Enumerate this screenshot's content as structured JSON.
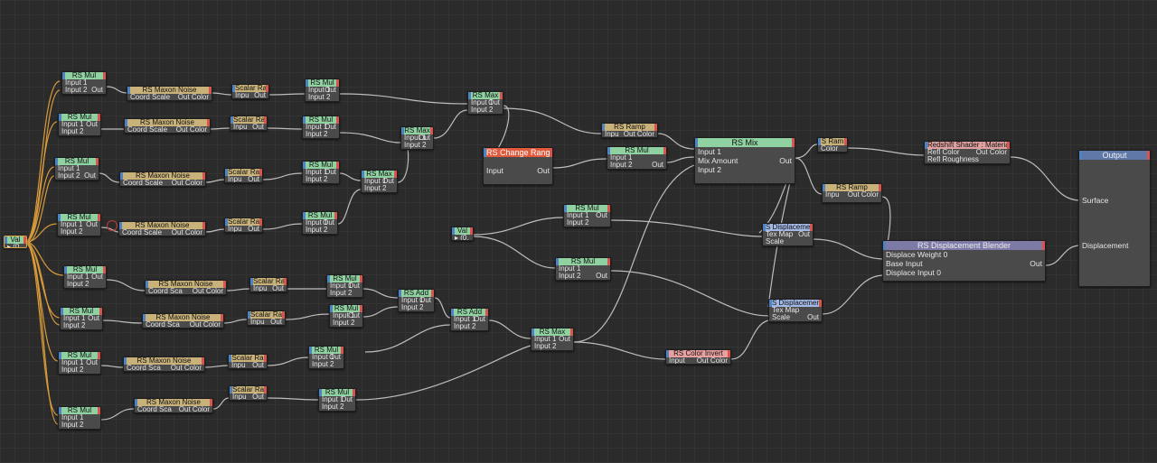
{
  "nodes": {
    "val_root": {
      "title": "Val",
      "rows": [
        [
          "▸ (0.",
          ""
        ]
      ]
    },
    "mul1": {
      "title": "RS Mul",
      "rows": [
        [
          "Input 1",
          ""
        ],
        [
          "Input 2",
          "Out"
        ]
      ]
    },
    "mul2": {
      "title": "RS Mul",
      "rows": [
        [
          "Input 1",
          "Out"
        ],
        [
          "Input 2",
          ""
        ]
      ]
    },
    "mul3": {
      "title": "RS Mul",
      "rows": [
        [
          "Input 1",
          ""
        ],
        [
          "Input 2",
          "Out"
        ]
      ]
    },
    "mul4": {
      "title": "RS Mul",
      "rows": [
        [
          "Input 1",
          "Out"
        ],
        [
          "Input 2",
          ""
        ]
      ]
    },
    "mul5": {
      "title": "RS Mul",
      "rows": [
        [
          "Input 1",
          "Out"
        ],
        [
          "Input 2",
          ""
        ]
      ]
    },
    "mul6": {
      "title": "RS Mul",
      "rows": [
        [
          "Input 1",
          "Out"
        ],
        [
          "Input 2",
          ""
        ]
      ]
    },
    "mul7": {
      "title": "RS Mul",
      "rows": [
        [
          "Input 1",
          "Out"
        ],
        [
          "Input 2",
          ""
        ]
      ]
    },
    "mul8": {
      "title": "RS Mul",
      "rows": [
        [
          "Input 1",
          ""
        ],
        [
          "Input 2",
          ""
        ]
      ]
    },
    "noise1": {
      "title": "RS Maxon Noise",
      "rows": [
        [
          "Coord Scale",
          "Out Color"
        ]
      ]
    },
    "noise2": {
      "title": "RS Maxon Noise",
      "rows": [
        [
          "Coord Scale",
          "Out Color"
        ]
      ]
    },
    "noise3": {
      "title": "RS Maxon Noise",
      "rows": [
        [
          "Coord Scale",
          "Out Color"
        ]
      ]
    },
    "noise4": {
      "title": "RS Maxon Noise",
      "rows": [
        [
          "Coord Scale",
          "Out Color"
        ]
      ]
    },
    "noise5": {
      "title": "RS Maxon Noise",
      "rows": [
        [
          "Coord Sca",
          "Out Color"
        ]
      ]
    },
    "noise6": {
      "title": "RS Maxon Noise",
      "rows": [
        [
          "Coord Sca",
          "Out Color"
        ]
      ]
    },
    "noise7": {
      "title": "RS Maxon Noise",
      "rows": [
        [
          "Coord Sca",
          "Out Color"
        ]
      ]
    },
    "noise8": {
      "title": "RS Maxon Noise",
      "rows": [
        [
          "Coord Sca",
          "Out Color"
        ]
      ]
    },
    "scal1": {
      "title": "Scalar Ra",
      "rows": [
        [
          "Inpu",
          "Out"
        ]
      ]
    },
    "scal2": {
      "title": "Scalar Ra",
      "rows": [
        [
          "Inpu",
          "Out"
        ]
      ]
    },
    "scal3": {
      "title": "Scalar Ra",
      "rows": [
        [
          "Inpu",
          "Out"
        ]
      ]
    },
    "scal4": {
      "title": "Scalar Ra",
      "rows": [
        [
          "Inpu",
          "Out"
        ]
      ]
    },
    "scal5": {
      "title": "Scalar Ra",
      "rows": [
        [
          "Inpu",
          "Out"
        ]
      ]
    },
    "scal6": {
      "title": "Scalar Ra",
      "rows": [
        [
          "Inpu",
          "Out"
        ]
      ]
    },
    "scal7": {
      "title": "Scalar Ra",
      "rows": [
        [
          "Inpu",
          "Out"
        ]
      ]
    },
    "scal8": {
      "title": "Scalar Ra",
      "rows": [
        [
          "Inpu",
          "Out"
        ]
      ]
    },
    "mulb1": {
      "title": "RS Mul",
      "rows": [
        [
          "Input 1",
          "Out"
        ],
        [
          "Input 2",
          ""
        ]
      ]
    },
    "mulb2": {
      "title": "RS Mul",
      "rows": [
        [
          "Input 1",
          "Out"
        ],
        [
          "Input 2",
          ""
        ]
      ]
    },
    "mulb3": {
      "title": "RS Mul",
      "rows": [
        [
          "Input 1",
          "Out"
        ],
        [
          "Input 2",
          ""
        ]
      ]
    },
    "mulb4": {
      "title": "RS Mul",
      "rows": [
        [
          "Input 1",
          "Out"
        ],
        [
          "Input 2",
          ""
        ]
      ]
    },
    "mulb5": {
      "title": "RS Mul",
      "rows": [
        [
          "Input 1",
          "Out"
        ],
        [
          "Input 2",
          ""
        ]
      ]
    },
    "mulb6": {
      "title": "RS Mul",
      "rows": [
        [
          "Input 1",
          "Out"
        ],
        [
          "Input 2",
          ""
        ]
      ]
    },
    "mulb7": {
      "title": "RS Mul",
      "rows": [
        [
          "Input 1",
          "Out"
        ],
        [
          "Input 2",
          ""
        ]
      ]
    },
    "mulb8": {
      "title": "RS Mul",
      "rows": [
        [
          "Input 1",
          "Out"
        ],
        [
          "Input 2",
          ""
        ]
      ]
    },
    "max1": {
      "title": "RS Max",
      "rows": [
        [
          "Input 1",
          "Out"
        ],
        [
          "Input 2",
          ""
        ]
      ]
    },
    "max2": {
      "title": "RS Max",
      "rows": [
        [
          "Input 1",
          "Out"
        ],
        [
          "Input 2",
          ""
        ]
      ]
    },
    "max3": {
      "title": "RS Max",
      "rows": [
        [
          "Input 1",
          "Out"
        ],
        [
          "Input 2",
          ""
        ]
      ]
    },
    "add1": {
      "title": "RS Add",
      "rows": [
        [
          "Input 1",
          "Out"
        ],
        [
          "Input 2",
          ""
        ]
      ]
    },
    "add2": {
      "title": "RS Add",
      "rows": [
        [
          "Input 1",
          "Out"
        ],
        [
          "Input 2",
          ""
        ]
      ]
    },
    "max4": {
      "title": "RS Max",
      "rows": [
        [
          "Input 1",
          "Out"
        ],
        [
          "Input 2",
          ""
        ]
      ]
    },
    "change": {
      "title": "RS Change Range",
      "rows": [
        [
          "",
          ""
        ],
        [
          "Input",
          "Out"
        ],
        [
          "",
          ""
        ],
        [
          "",
          ""
        ]
      ]
    },
    "ramp1": {
      "title": "RS Ramp",
      "rows": [
        [
          "Inpu",
          "Out Color"
        ]
      ]
    },
    "mulc": {
      "title": "RS Mul",
      "rows": [
        [
          "Input 1",
          ""
        ],
        [
          "Input 2",
          "Out"
        ]
      ]
    },
    "mix": {
      "title": "RS Mix",
      "rows": [
        [
          "Input 1",
          ""
        ],
        [
          "Mix Amount",
          "Out"
        ],
        [
          "Input 2",
          ""
        ],
        [
          "",
          ""
        ]
      ]
    },
    "ramp2": {
      "title": "S Ram",
      "rows": [
        [
          "Color",
          ""
        ]
      ]
    },
    "shader": {
      "title": "Redshift Shader : Materia",
      "rows": [
        [
          "Refl Color",
          "Out Color"
        ],
        [
          "Refl Roughness",
          ""
        ]
      ]
    },
    "ramp3": {
      "title": "RS Ramp",
      "rows": [
        [
          "Inpu",
          "Out Color"
        ]
      ]
    },
    "val2": {
      "title": "Val",
      "rows": [
        [
          "▸ (0.",
          ""
        ]
      ]
    },
    "muld1": {
      "title": "RS Mul",
      "rows": [
        [
          "Input 1",
          "Out"
        ],
        [
          "Input 2",
          ""
        ]
      ]
    },
    "muld2": {
      "title": "RS Mul",
      "rows": [
        [
          "Input 1",
          ""
        ],
        [
          "Input 2",
          "Out"
        ]
      ]
    },
    "disp1": {
      "title": "S Displacemer",
      "rows": [
        [
          "Tex Map",
          "Out"
        ],
        [
          "Scale",
          ""
        ]
      ]
    },
    "disp2": {
      "title": "S Displacemer",
      "rows": [
        [
          "Tex Map",
          ""
        ],
        [
          "Scale",
          "Out"
        ]
      ]
    },
    "blend": {
      "title": "RS Displacement Blender",
      "rows": [
        [
          "Displace Weight 0",
          ""
        ],
        [
          "Base Input",
          "Out"
        ],
        [
          "Displace Input 0",
          ""
        ],
        [
          "",
          ""
        ]
      ]
    },
    "inv": {
      "title": "RS Color Invert",
      "rows": [
        [
          "Input",
          "Out Color"
        ]
      ]
    },
    "output": {
      "title": "Output",
      "rows": [
        [
          "",
          ""
        ],
        [
          "",
          ""
        ],
        [
          "",
          ""
        ],
        [
          "",
          ""
        ],
        [
          "Surface",
          ""
        ],
        [
          "",
          ""
        ],
        [
          "",
          ""
        ],
        [
          "",
          ""
        ],
        [
          "",
          ""
        ],
        [
          "Displacement",
          ""
        ],
        [
          "",
          ""
        ],
        [
          "",
          ""
        ],
        [
          "",
          ""
        ],
        [
          "",
          ""
        ]
      ]
    }
  }
}
